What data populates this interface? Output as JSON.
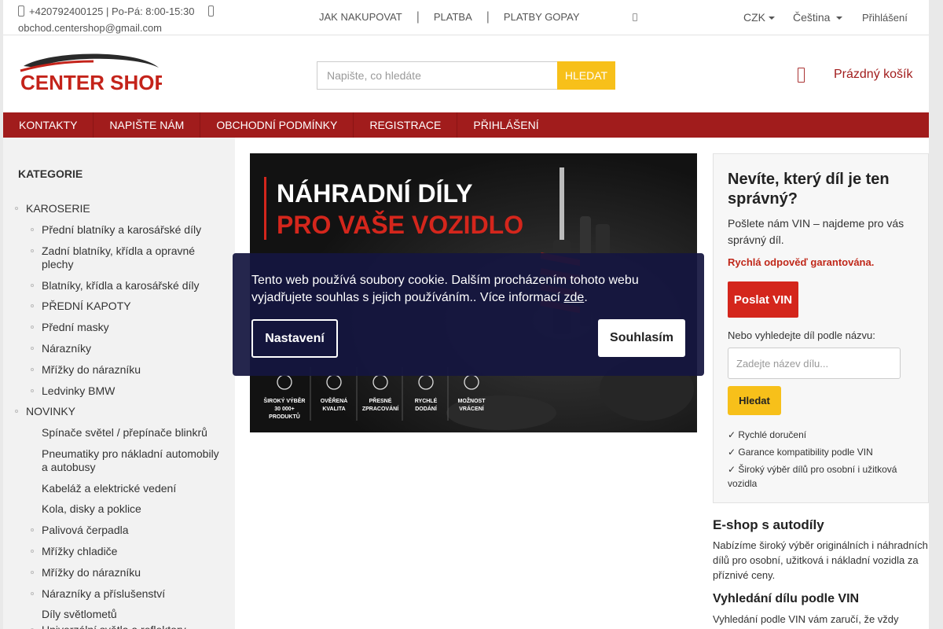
{
  "topbar": {
    "phone_hours": "+420792400125 | Po-Pá: 8:00-15:30",
    "email": "obchod.centershop@gmail.com",
    "links": [
      "JAK NAKUPOVAT",
      "PLATBA",
      "PLATBY GOPAY"
    ],
    "currency": "CZK",
    "language": "Čeština",
    "login": "Přihlášení"
  },
  "header": {
    "logo_text": "CENTER SHOP",
    "search_placeholder": "Napište, co hledáte",
    "search_button": "HLEDAT",
    "cart": "Prázdný košík"
  },
  "nav": [
    "KONTAKTY",
    "NAPIŠTE NÁM",
    "OBCHODNÍ PODMÍNKY",
    "REGISTRACE",
    "PŘIHLÁŠENÍ"
  ],
  "sidebar": {
    "title": "KATEGORIE",
    "items": [
      {
        "label": "KAROSERIE",
        "level": 0,
        "bullet": true
      },
      {
        "label": "Přední blatníky a karosářské díly",
        "level": 1,
        "bullet": true
      },
      {
        "label": "Zadní blatníky, křídla a opravné plechy",
        "level": 1,
        "bullet": true
      },
      {
        "label": "Blatníky, křídla a karosářské díly",
        "level": 1,
        "bullet": true
      },
      {
        "label": "PŘEDNÍ KAPOTY",
        "level": 1,
        "bullet": true
      },
      {
        "label": "Přední masky",
        "level": 1,
        "bullet": true
      },
      {
        "label": "Nárazníky",
        "level": 1,
        "bullet": true
      },
      {
        "label": "Mřížky do nárazníku",
        "level": 1,
        "bullet": true
      },
      {
        "label": "Ledvinky BMW",
        "level": 1,
        "bullet": true
      },
      {
        "label": "NOVINKY",
        "level": 0,
        "bullet": true
      },
      {
        "label": "Spínače světel / přepínače blinkrů",
        "level": 1,
        "bullet": false
      },
      {
        "label": "Pneumatiky pro nákladní automobily a autobusy",
        "level": 1,
        "bullet": false
      },
      {
        "label": "Kabeláž a elektrické vedení",
        "level": 1,
        "bullet": false
      },
      {
        "label": "Kola, disky a poklice",
        "level": 1,
        "bullet": false
      },
      {
        "label": "Palivová čerpadla",
        "level": 1,
        "bullet": true
      },
      {
        "label": "Mřížky chladiče",
        "level": 1,
        "bullet": true
      },
      {
        "label": "Mřížky do nárazníku",
        "level": 1,
        "bullet": true
      },
      {
        "label": "Nárazníky a příslušenství",
        "level": 1,
        "bullet": true
      },
      {
        "label": "Díly světlometů",
        "level": 1,
        "bullet": false
      },
      {
        "label": "Univerzální světla a reflektory",
        "level": 1,
        "bullet": true
      }
    ]
  },
  "banner": {
    "line1": "NÁHRADNÍ DÍLY",
    "line2": "PRO VAŠE VOZIDLO",
    "features": [
      {
        "icon": "search-icon",
        "l1": "ŠIROKÝ VÝBĚR",
        "l2": "30 000+",
        "l3": "PRODUKTŮ"
      },
      {
        "icon": "shield-check-icon",
        "l1": "OVĚŘENÁ",
        "l2": "KVALITA",
        "l3": ""
      },
      {
        "icon": "gear-icon",
        "l1": "PŘESNÉ",
        "l2": "ZPRACOVÁNÍ",
        "l3": ""
      },
      {
        "icon": "truck-icon",
        "l1": "RYCHLÉ",
        "l2": "DODÁNÍ",
        "l3": ""
      },
      {
        "icon": "box-icon",
        "l1": "MOŽNOST",
        "l2": "VRÁCENÍ",
        "l3": ""
      }
    ]
  },
  "vin": {
    "heading": "Nevíte, který díl je ten správný?",
    "text": "Pošlete nám VIN – najdeme pro vás správný díl.",
    "guarantee": "Rychlá odpověď garantována.",
    "send_button": "Poslat VIN",
    "or_text": "Nebo vyhledejte díl podle názvu:",
    "input_placeholder": "Zadejte název dílu...",
    "search_button": "Hledat",
    "features": [
      "✓ Rychlé doručení",
      "✓ Garance kompatibility podle VIN",
      "✓ Široký výběr dílů pro osobní i užitková vozidla"
    ]
  },
  "eshop": {
    "heading": "E-shop s autodíly",
    "text": "Nabízíme široký výběr originálních i náhradních dílů pro osobní, užitková i nákladní vozidla za příznivé ceny."
  },
  "vin_section": {
    "heading": "Vyhledání dílu podle VIN",
    "text": "Vyhledání podle VIN vám zaručí, že vždy"
  },
  "cookie": {
    "text_before": "Tento web používá soubory cookie. Dalším procházením tohoto webu vyjadřujete souhlas s jejich používáním.. Více informací ",
    "link": "zde",
    "text_after": ".",
    "settings": "Nastavení",
    "agree": "Souhlasím"
  },
  "colors": {
    "brand_red": "#a11c1c",
    "accent_yellow": "#f7c01a",
    "cookie_bg": "#141640"
  }
}
